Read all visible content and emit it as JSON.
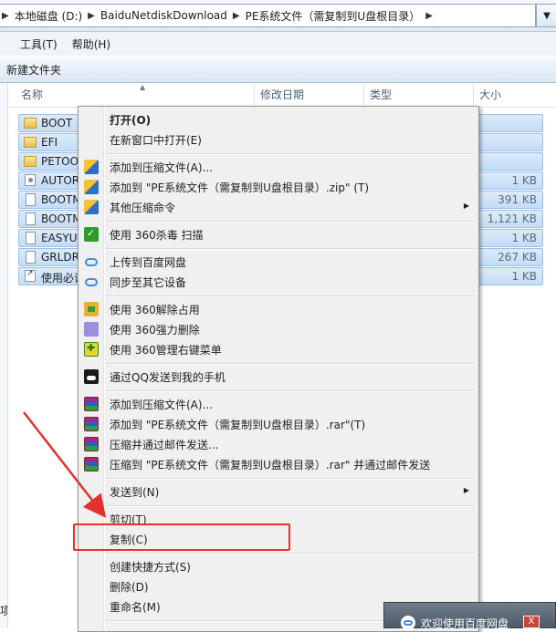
{
  "address_bar": {
    "crumbs": [
      "本地磁盘 (D:)",
      "BaiduNetdiskDownload",
      "PE系统文件（需复制到U盘根目录）"
    ],
    "separator": "▶",
    "dropdown": "▼"
  },
  "menubar": {
    "items": [
      "",
      "工具(T)",
      "帮助(H)"
    ]
  },
  "toolbar": {
    "new_folder": "新建文件夹"
  },
  "columns": {
    "name": "名称",
    "date": "修改日期",
    "type": "类型",
    "size": "大小",
    "sort": "▲"
  },
  "files": [
    {
      "name": "BOOT",
      "size": "",
      "kind": "folder"
    },
    {
      "name": "EFI",
      "size": "",
      "kind": "folder"
    },
    {
      "name": "PETOO",
      "size": "",
      "kind": "folder"
    },
    {
      "name": "AUTOR",
      "size": "1 KB",
      "kind": "sys"
    },
    {
      "name": "BOOTM",
      "size": "391 KB",
      "kind": "doc"
    },
    {
      "name": "BOOTM",
      "size": "1,121 KB",
      "kind": "doc"
    },
    {
      "name": "EASYU",
      "size": "1 KB",
      "kind": "doc"
    },
    {
      "name": "GRLDR",
      "size": "267 KB",
      "kind": "doc"
    },
    {
      "name": "使用必读",
      "size": "1 KB",
      "kind": "lnk"
    }
  ],
  "left_pane": {
    "top_label": "",
    "bottom_label": "项"
  },
  "context_menu": {
    "items": [
      {
        "label": "打开(O)",
        "bold": true
      },
      {
        "label": "在新窗口中打开(E)"
      },
      {
        "label": "添加到压缩文件(A)...",
        "icon": "winzip"
      },
      {
        "label": "添加到 \"PE系统文件（需复制到U盘根目录）.zip\" (T)",
        "icon": "winzip"
      },
      {
        "label": "其他压缩命令",
        "icon": "winzip",
        "submenu": true
      },
      {
        "label": "使用 360杀毒 扫描",
        "icon": "shield"
      },
      {
        "label": "上传到百度网盘",
        "icon": "cloud"
      },
      {
        "label": "同步至其它设备",
        "icon": "cloud"
      },
      {
        "label": "使用 360解除占用",
        "icon": "unlock"
      },
      {
        "label": "使用 360强力删除",
        "icon": "trash"
      },
      {
        "label": "使用 360管理右键菜单",
        "icon": "gear"
      },
      {
        "label": "通过QQ发送到我的手机",
        "icon": "qq"
      },
      {
        "label": "添加到压缩文件(A)...",
        "icon": "rar"
      },
      {
        "label": "添加到 \"PE系统文件（需复制到U盘根目录）.rar\"(T)",
        "icon": "rar"
      },
      {
        "label": "压缩并通过邮件发送...",
        "icon": "rar"
      },
      {
        "label": "压缩到 \"PE系统文件（需复制到U盘根目录）.rar\" 并通过邮件发送",
        "icon": "rar"
      },
      {
        "label": "发送到(N)",
        "submenu": true
      },
      {
        "label": "剪切(T)"
      },
      {
        "label": "复制(C)"
      },
      {
        "label": "创建快捷方式(S)"
      },
      {
        "label": "删除(D)"
      },
      {
        "label": "重命名(M)"
      }
    ],
    "submenu_arrow": "▶"
  },
  "notification": {
    "text": "欢迎使用百度网盘",
    "close": "X"
  },
  "colors": {
    "highlight": "#e4312b",
    "selection": "#cce0f7"
  }
}
